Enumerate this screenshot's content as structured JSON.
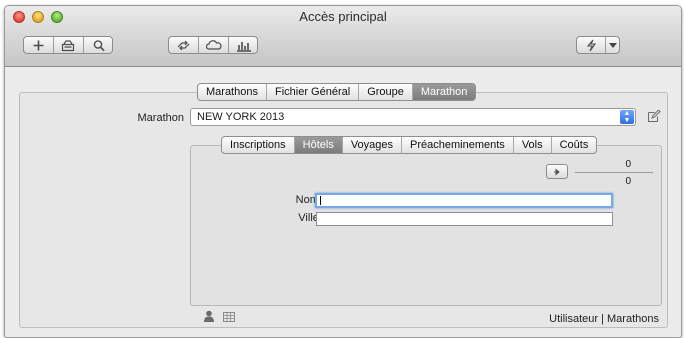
{
  "window": {
    "title": "Accès principal"
  },
  "toolbar": {
    "left_icons": [
      "plus-icon",
      "print-icon",
      "search-icon"
    ],
    "mid_icons": [
      "sync-arrows-icon",
      "cloud-icon",
      "bar-chart-icon"
    ],
    "right_icons": [
      "lightning-icon",
      "chevron-down-icon"
    ]
  },
  "top_tabs": [
    "Marathons",
    "Fichier Général",
    "Groupe",
    "Marathon"
  ],
  "top_tabs_active": "Marathon",
  "marathon_field": {
    "label": "Marathon",
    "value": "NEW YORK 2013"
  },
  "sub_tabs": [
    "Inscriptions",
    "Hôtels",
    "Voyages",
    "Préacheminements",
    "Vols",
    "Coûts"
  ],
  "sub_tabs_active": "Hôtels",
  "counter": {
    "top": "0",
    "bottom": "0"
  },
  "form": {
    "nom_label": "Nom :",
    "nom_value": "",
    "ville_label": "Ville :",
    "ville_value": ""
  },
  "footer": {
    "status": "Utilisateur | Marathons",
    "icons": [
      "user-icon",
      "table-icon"
    ]
  },
  "colors": {
    "accent": "#2c6fe0",
    "active_tab": "#858585"
  }
}
